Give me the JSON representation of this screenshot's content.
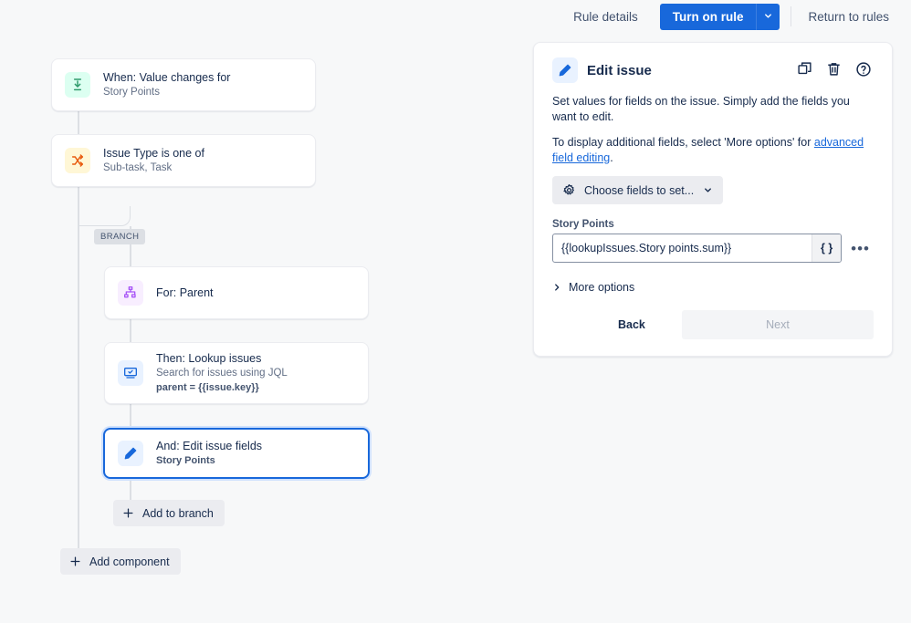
{
  "topbar": {
    "rule_details_label": "Rule details",
    "turn_on_label": "Turn on rule",
    "turn_on_caret_icon": "chevron-down-icon",
    "return_label": "Return to rules",
    "accent_color": "#1868db"
  },
  "canvas": {
    "branch_chip_label": "BRANCH",
    "add_to_branch_label": "Add to branch",
    "add_component_label": "Add component",
    "nodes": [
      {
        "title": "When: Value changes for",
        "subtitle": "Story Points",
        "icon": "value-change-icon",
        "icon_color": "#2e9a6b",
        "icon_bg": "#dcfff1",
        "selected": false
      },
      {
        "title": "Issue Type is one of",
        "subtitle": "Sub-task, Task",
        "icon": "shuffle-icon",
        "icon_color": "#e8590c",
        "icon_bg": "#fff7d6",
        "selected": false
      },
      {
        "title": "For: Parent",
        "subtitle": "",
        "icon": "hierarchy-icon",
        "icon_color": "#a855f7",
        "icon_bg": "#f8eeff",
        "selected": false
      },
      {
        "title": "Then: Lookup issues",
        "subtitle": "Search for issues using JQL",
        "subtitle2": "parent = {{issue.key}}",
        "icon": "monitor-check-icon",
        "icon_color": "#1868db",
        "icon_bg": "#e9f2ff",
        "selected": false
      },
      {
        "title": "And: Edit issue fields",
        "subtitle": "Story Points",
        "icon": "pencil-icon",
        "icon_color": "#1868db",
        "icon_bg": "#e9f2ff",
        "selected": true
      }
    ]
  },
  "panel": {
    "title": "Edit issue",
    "title_icon": "pencil-icon",
    "actions": [
      {
        "name": "duplicate-icon",
        "label": "Duplicate"
      },
      {
        "name": "trash-icon",
        "label": "Delete"
      },
      {
        "name": "help-icon",
        "label": "Help"
      }
    ],
    "description": "Set values for fields on the issue. Simply add the fields you want to edit.",
    "hint_prefix": "To display additional fields, select 'More options' for ",
    "hint_link": "advanced field editing",
    "hint_suffix": ".",
    "choose_fields_label": "Choose fields to set...",
    "choose_fields_icon": "gear-icon",
    "field": {
      "label": "Story Points",
      "value": "{{lookupIssues.Story points.sum}}",
      "smart_value_button_label": "{ }",
      "overflow_menu_label": "•••"
    },
    "more_options_label": "More options",
    "more_options_icon": "chevron-right-icon",
    "back_label": "Back",
    "next_label": "Next",
    "next_disabled": true
  }
}
